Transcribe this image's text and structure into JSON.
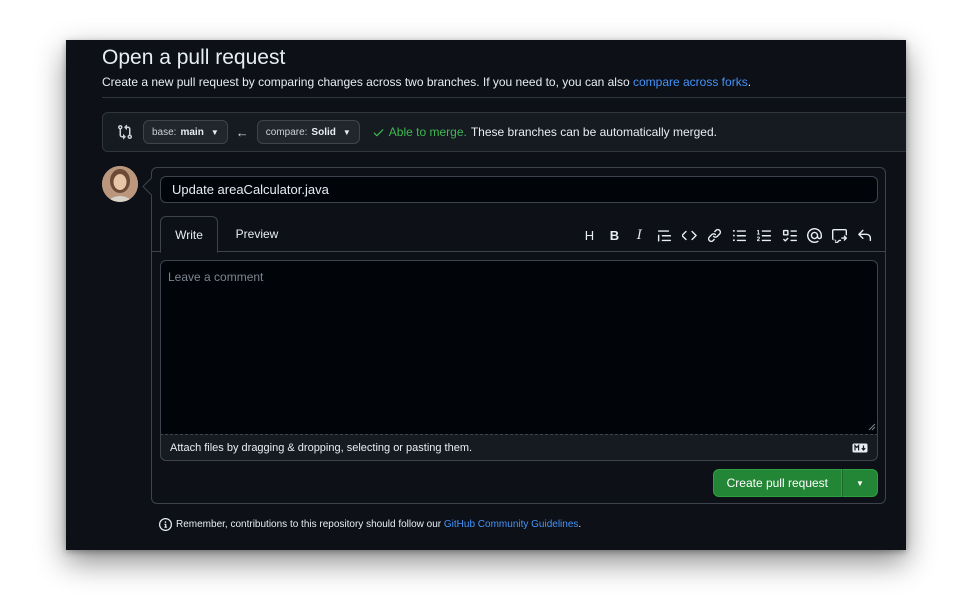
{
  "header": {
    "title": "Open a pull request",
    "subtitle": "Create a new pull request by comparing changes across two branches. If you need to, you can also ",
    "subtitle_link": "compare across forks",
    "subtitle_end": "."
  },
  "range": {
    "base_prefix": "base:",
    "base_branch": "main",
    "compare_prefix": "compare:",
    "compare_branch": "Solid",
    "merge_ok": "Able to merge.",
    "merge_msg": "These branches can be automatically merged."
  },
  "composer": {
    "title_value": "Update areaCalculator.java",
    "tabs": [
      {
        "label": "Write"
      },
      {
        "label": "Preview"
      }
    ],
    "toolbar": [
      "heading-icon",
      "bold-icon",
      "italic-icon",
      "quote-icon",
      "code-icon",
      "link-icon",
      "unordered-list-icon",
      "ordered-list-icon",
      "task-list-icon",
      "mention-icon",
      "reference-icon",
      "undo-icon"
    ],
    "comment_placeholder": "Leave a comment",
    "attach_text": "Attach files by dragging & dropping, selecting or pasting them.",
    "submit_label": "Create pull request"
  },
  "footer": {
    "reminder_text": "Remember, contributions to this repository should follow our ",
    "reminder_link": "GitHub Community Guidelines",
    "reminder_end": "."
  },
  "colors": {
    "background": "#0d1117",
    "accent_green": "#238636",
    "link_blue": "#4493f8",
    "success_green": "#3fb950"
  }
}
